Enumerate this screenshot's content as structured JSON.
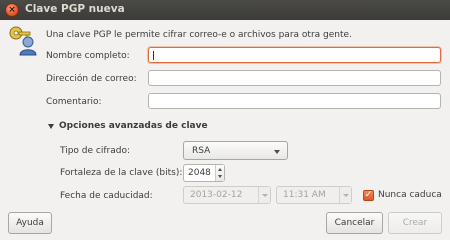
{
  "window": {
    "title": "Clave PGP nueva"
  },
  "intro": "Una clave PGP le permite cifrar correo-e o archivos para otra gente.",
  "fields": {
    "name_label": "Nombre completo:",
    "name_value": "",
    "email_label": "Dirección de correo:",
    "email_value": "",
    "comment_label": "Comentario:",
    "comment_value": ""
  },
  "advanced": {
    "header": "Opciones avanzadas de clave",
    "cipher_label": "Tipo de cifrado:",
    "cipher_value": "RSA",
    "strength_label": "Fortaleza de la clave (bits):",
    "strength_value": "2048",
    "expiry_label": "Fecha de caducidad:",
    "expiry_date": "2013-02-12",
    "expiry_time": "11:31 AM",
    "never_expires_label": "Nunca caduca",
    "never_expires_checked": true
  },
  "buttons": {
    "help": "Ayuda",
    "cancel": "Cancelar",
    "create": "Crear"
  },
  "colors": {
    "accent": "#e36b38",
    "titlebar": "#3c3b37"
  }
}
